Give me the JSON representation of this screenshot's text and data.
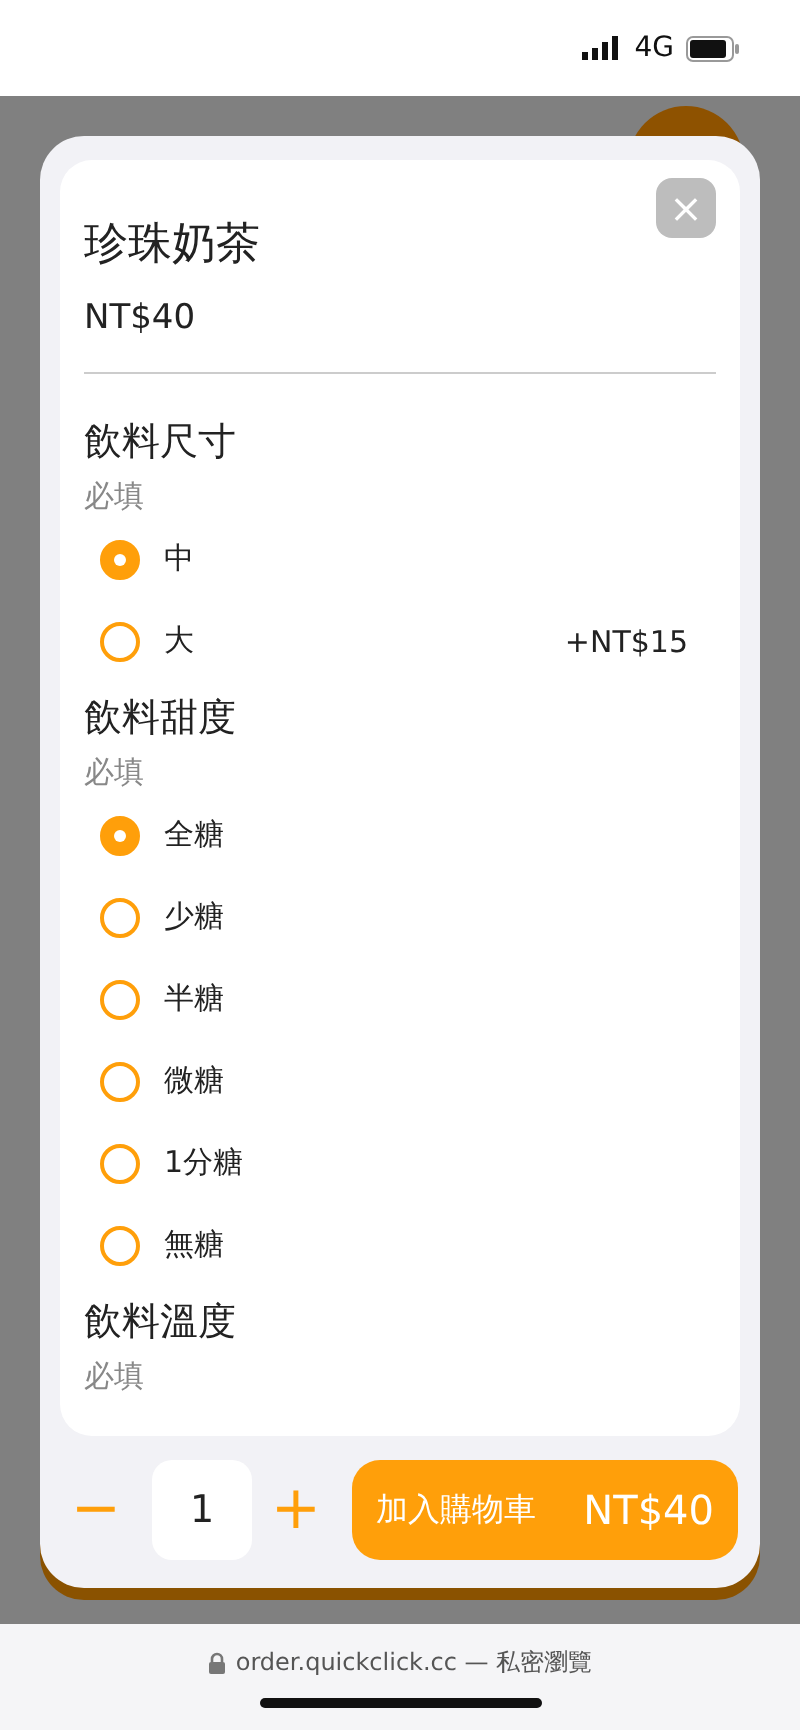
{
  "status_bar": {
    "network": "4G"
  },
  "item": {
    "title": "珍珠奶茶",
    "price": "NT$40",
    "close": "×"
  },
  "groups": [
    {
      "title": "飲料尺寸",
      "note": "必填",
      "options": [
        {
          "label": "中",
          "selected": true
        },
        {
          "label": "大",
          "selected": false,
          "price": "+NT$15"
        }
      ]
    },
    {
      "title": "飲料甜度",
      "note": "必填",
      "options": [
        {
          "label": "全糖",
          "selected": true
        },
        {
          "label": "少糖",
          "selected": false
        },
        {
          "label": "半糖",
          "selected": false
        },
        {
          "label": "微糖",
          "selected": false
        },
        {
          "label": "1分糖",
          "selected": false
        },
        {
          "label": "無糖",
          "selected": false
        }
      ]
    },
    {
      "title": "飲料溫度",
      "note": "必填"
    }
  ],
  "quantity": {
    "minus": "−",
    "value": "1",
    "plus": "+"
  },
  "add_button": {
    "label": "加入購物車",
    "price": "NT$40"
  },
  "browser_bar": {
    "url": "order.quickclick.cc — 私密瀏覽"
  }
}
